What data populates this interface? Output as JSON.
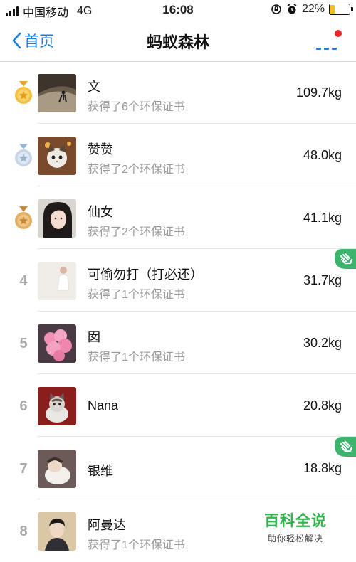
{
  "status_bar": {
    "carrier": "中国移动",
    "network": "4G",
    "time": "16:08",
    "battery": "22%",
    "battery_level": 0.22
  },
  "nav": {
    "back_label": "首页",
    "title": "蚂蚁森林"
  },
  "colors": {
    "accent": "#1a7fe0",
    "notify_dot": "#e8262b",
    "hand_badge": "#3cb46e",
    "watermark": "#2fb34a"
  },
  "list": [
    {
      "rank_icon": "gold-medal-icon",
      "name": "文",
      "sub": "获得了6个环保证书",
      "amount": "109.7kg",
      "avatar": "cave-photo"
    },
    {
      "rank_icon": "silver-medal-icon",
      "name": "赞赞",
      "sub": "获得了2个环保证书",
      "amount": "48.0kg",
      "avatar": "cat-photo"
    },
    {
      "rank_icon": "bronze-medal-icon",
      "name": "仙女",
      "sub": "获得了2个环保证书",
      "amount": "41.1kg",
      "avatar": "woman-photo"
    },
    {
      "rank": "4",
      "name": "可偷勿打（打必还）",
      "sub": "获得了1个环保证书",
      "amount": "31.7kg",
      "avatar": "light-photo",
      "hand": true
    },
    {
      "rank": "5",
      "name": "囡",
      "sub": "获得了1个环保证书",
      "amount": "30.2kg",
      "avatar": "flowers-photo"
    },
    {
      "rank": "6",
      "name": "Nana",
      "sub": "",
      "amount": "20.8kg",
      "avatar": "kitten-photo"
    },
    {
      "rank": "7",
      "name": "银维",
      "sub": "",
      "amount": "18.8kg",
      "avatar": "baby-photo",
      "hand": true
    },
    {
      "rank": "8",
      "name": "阿曼达",
      "sub": "获得了1个环保证书",
      "amount": "",
      "avatar": "man-photo"
    }
  ],
  "watermark": {
    "title": "百科全说",
    "subtitle": "助你轻松解决"
  }
}
